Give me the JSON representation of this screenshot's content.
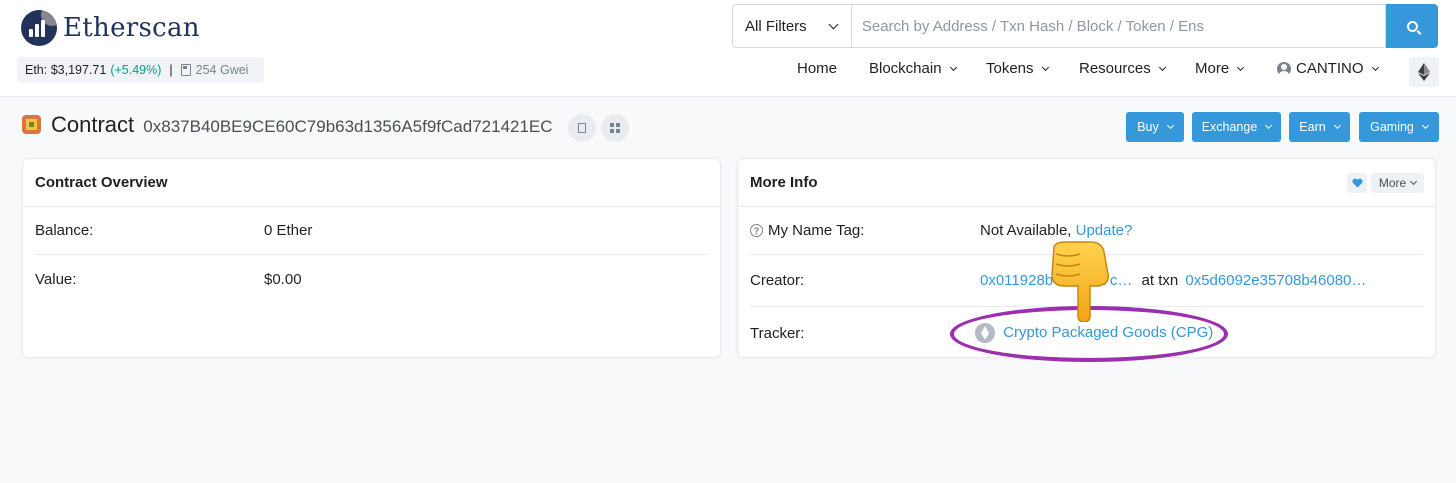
{
  "header": {
    "logo_text": "Etherscan",
    "eth_price_label": "Eth: $3,197.71",
    "eth_price_change": "(+5.49%)",
    "separator": "|",
    "gas": "254 Gwei"
  },
  "search": {
    "filter_label": "All Filters",
    "placeholder": "Search by Address / Txn Hash / Block / Token / Ens"
  },
  "nav": {
    "home": "Home",
    "blockchain": "Blockchain",
    "tokens": "Tokens",
    "resources": "Resources",
    "more": "More",
    "user": "CANTINO"
  },
  "page": {
    "title": "Contract",
    "address": "0x837B40BE9CE60C79b63d1356A5f9fCad721421EC"
  },
  "actions": {
    "buy": "Buy",
    "exchange": "Exchange",
    "earn": "Earn",
    "gaming": "Gaming"
  },
  "overview": {
    "title": "Contract Overview",
    "balance_label": "Balance:",
    "balance_value": "0 Ether",
    "value_label": "Value:",
    "value_value": "$0.00"
  },
  "more_info": {
    "title": "More Info",
    "more_label": "More",
    "name_tag_label": "My Name Tag:",
    "name_tag_value": "Not Available,",
    "name_tag_link": "Update?",
    "creator_label": "Creator:",
    "creator_address": "0x011928b4…2887c…",
    "creator_at": "at txn",
    "creator_txn": "0x5d6092e35708b46080…",
    "tracker_label": "Tracker:",
    "tracker_value": "Crypto Packaged Goods (CPG)"
  },
  "colors": {
    "accent": "#3498db",
    "positive": "#00a186",
    "annotation": "#9b2fae"
  },
  "icons": [
    "search-icon",
    "user-icon",
    "ethereum-icon",
    "copy-icon",
    "qr-code-icon",
    "heart-icon",
    "question-icon",
    "token-icon",
    "pointing-hand-icon"
  ]
}
